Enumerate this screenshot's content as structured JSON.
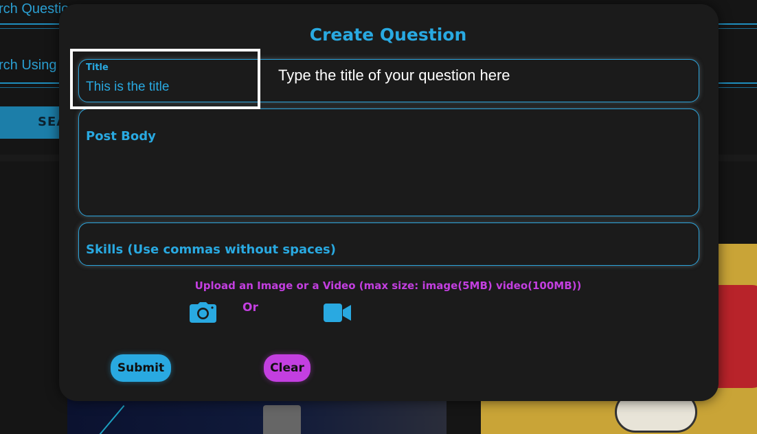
{
  "background": {
    "search_row_1": "rch Question",
    "search_row_2": "rch Using",
    "search_button": "SEA"
  },
  "modal": {
    "title": "Create Question",
    "title_field": {
      "label": "Title",
      "value": "This is the title"
    },
    "body_field": {
      "placeholder": "Post Body"
    },
    "skills_field": {
      "placeholder": "Skills (Use commas without spaces)"
    },
    "upload_hint": "Upload an Image or a Video (max size: image(5MB) video(100MB))",
    "or_text": "Or",
    "icons": {
      "image_upload": "camera-icon",
      "video_upload": "video-camera-icon"
    },
    "submit_label": "Submit",
    "clear_label": "Clear"
  },
  "annotation": {
    "tooltip": "Type the title of your question here"
  },
  "colors": {
    "accent_blue": "#29a9e1",
    "accent_purple": "#c33fe0",
    "modal_bg": "#1b1b1b",
    "page_bg": "#151515"
  }
}
